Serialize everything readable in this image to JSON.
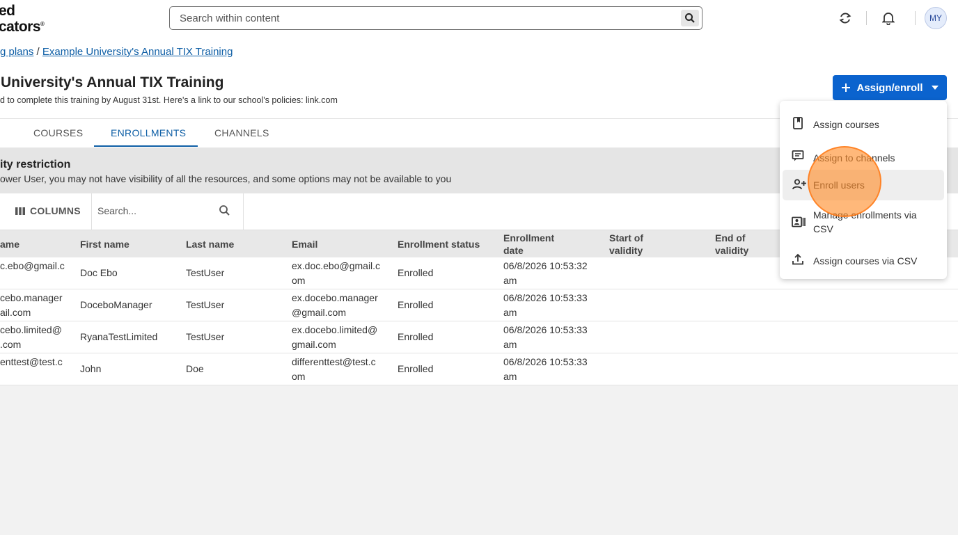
{
  "header": {
    "logo_line1": "ed",
    "logo_line2": "cators",
    "search_placeholder": "Search within content",
    "avatar_initials": "MY"
  },
  "breadcrumb": {
    "parent": "g plans",
    "separator": " / ",
    "current": "Example University's Annual TIX Training"
  },
  "page": {
    "title": "University's Annual TIX Training",
    "description": "d to complete this training by August 31st.  Here's a link to our school's policies: link.com",
    "assign_button": "Assign/enroll"
  },
  "tabs": [
    {
      "label": "COURSES",
      "active": false
    },
    {
      "label": "ENROLLMENTS",
      "active": true
    },
    {
      "label": "CHANNELS",
      "active": false
    }
  ],
  "notice": {
    "title": "ity restriction",
    "text": "ower User, you may not have visibility of all the resources, and some options may not be available to you"
  },
  "toolbar": {
    "columns_label": "COLUMNS",
    "search_placeholder": "Search..."
  },
  "table": {
    "columns": [
      "ame",
      "First name",
      "Last name",
      "Email",
      "Enrollment status",
      "Enrollment\ndate",
      "Start of\nvalidity",
      "End of\nvalidity"
    ],
    "rows": [
      {
        "username": "c.ebo@gmail.c",
        "first": "Doc Ebo",
        "last": "TestUser",
        "email": "ex.doc.ebo@gmail.c\nom",
        "status": "Enrolled",
        "date": "06/8/2026 10:53:32\nam",
        "start": "",
        "end": ""
      },
      {
        "username": "cebo.manager\nail.com",
        "first": "DoceboManager",
        "last": "TestUser",
        "email": "ex.docebo.manager\n@gmail.com",
        "status": "Enrolled",
        "date": "06/8/2026 10:53:33\nam",
        "start": "",
        "end": ""
      },
      {
        "username": "cebo.limited@\n.com",
        "first": "RyanaTestLimited",
        "last": "TestUser",
        "email": "ex.docebo.limited@\ngmail.com",
        "status": "Enrolled",
        "date": "06/8/2026 10:53:33\nam",
        "start": "",
        "end": ""
      },
      {
        "username": "enttest@test.c",
        "first": "John",
        "last": "Doe",
        "email": "differenttest@test.c\nom",
        "status": "Enrolled",
        "date": "06/8/2026 10:53:33\nam",
        "start": "",
        "end": ""
      }
    ]
  },
  "dropdown": {
    "items": [
      {
        "label": "Assign courses",
        "icon": "book-icon"
      },
      {
        "label": "Assign to channels",
        "icon": "channel-icon"
      },
      {
        "label": "Enroll users",
        "icon": "person-add-icon",
        "hovered": true
      },
      {
        "label": "Manage enrollments via\nCSV",
        "icon": "id-card-icon"
      },
      {
        "label": "Assign courses via CSV",
        "icon": "upload-icon"
      }
    ]
  },
  "colors": {
    "accent": "#0b63ce",
    "link": "#0f5fa6",
    "click_indicator": "#ff8c28"
  }
}
